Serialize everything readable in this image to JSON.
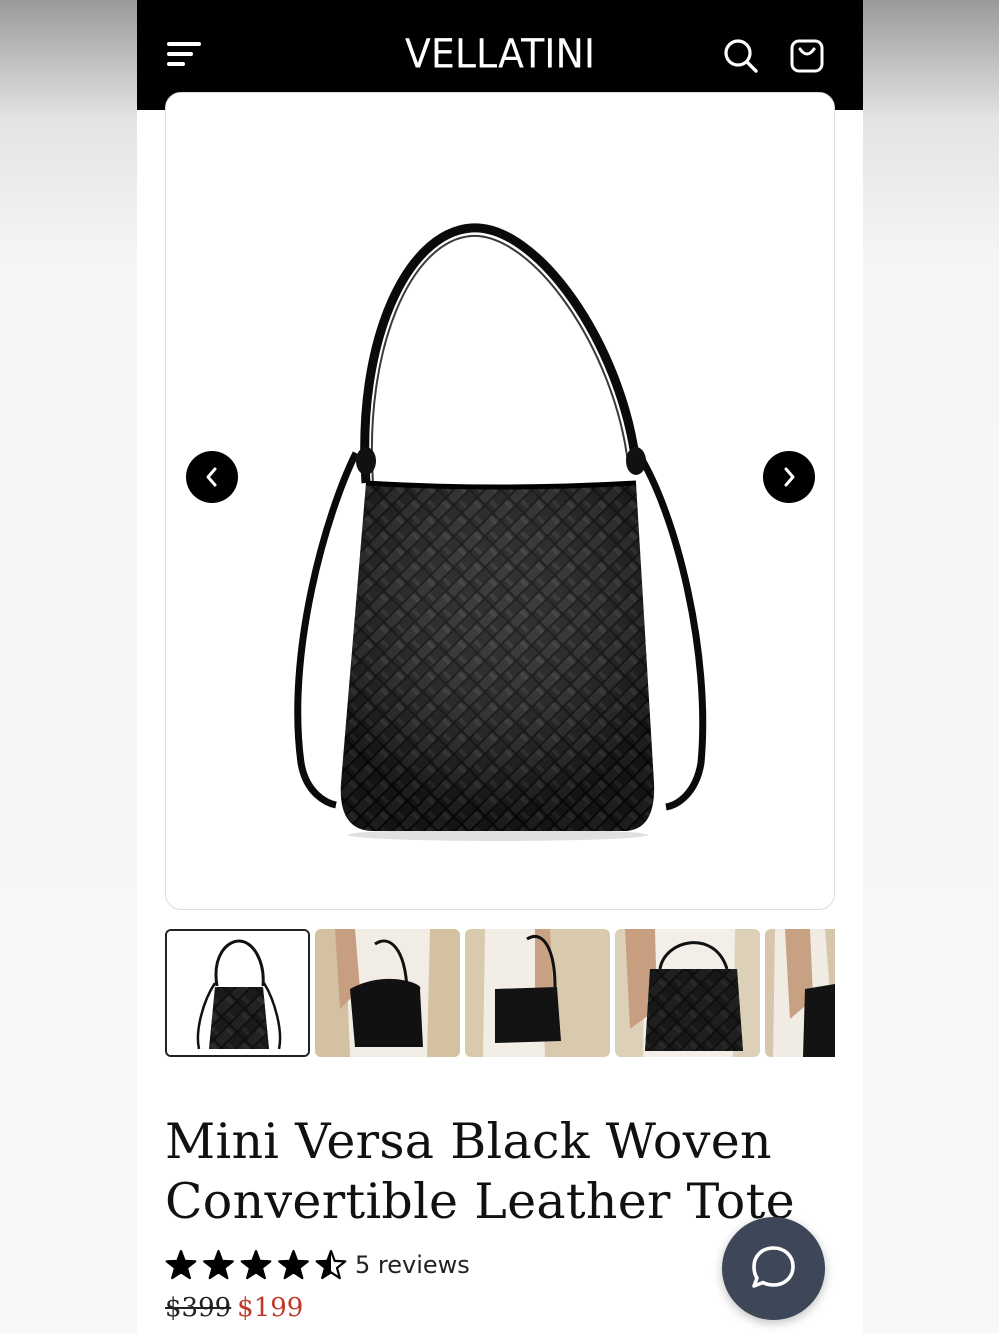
{
  "header": {
    "brand": "VELLATINI",
    "menu_icon": "hamburger-menu-icon",
    "search_icon": "search-icon",
    "cart_icon": "shopping-bag-icon"
  },
  "gallery": {
    "prev_icon": "chevron-left-icon",
    "next_icon": "chevron-right-icon",
    "thumbnails": [
      "Product front view",
      "Model carrying bag",
      "Model side view",
      "Model shoulder view",
      "Model back view"
    ]
  },
  "product": {
    "title_line1": "Mini Versa Black Woven",
    "title_line2": "Convertible Leather Tote",
    "rating": 4.5,
    "rating_max": 5,
    "reviews": "5 reviews",
    "price_original": "$399",
    "price_sale": "$199"
  },
  "colors": {
    "header_bg": "#000000",
    "sale_price": "#c0392b",
    "chat_button": "#3d4758"
  },
  "chat": {
    "icon": "chat-bubble-icon"
  }
}
